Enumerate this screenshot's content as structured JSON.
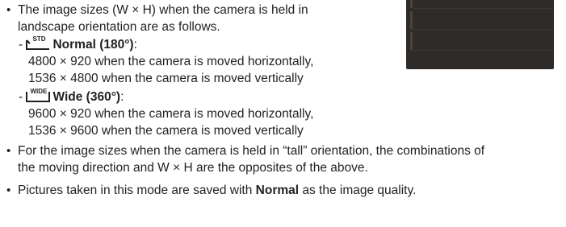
{
  "thumbnail": {
    "kind": "dark-image-thumbnail"
  },
  "bullets": [
    {
      "lines": [
        "The image sizes (W × H) when the camera is held in",
        "landscape orientation are as follows."
      ]
    }
  ],
  "modes": [
    {
      "icon_label": "STD",
      "name": "Normal (180°)",
      "suffix": ":",
      "lines": [
        "4800 × 920 when the camera is moved horizontally,",
        "1536 × 4800 when the camera is moved vertically"
      ]
    },
    {
      "icon_label": "WIDE",
      "name": "Wide (360°)",
      "suffix": ":",
      "lines": [
        "9600 × 920 when the camera is moved horizontally,",
        "1536 × 9600 when the camera is moved vertically"
      ]
    }
  ],
  "bullet2": {
    "lines": [
      "For the image sizes when the camera is held in “tall” orientation, the combinations of",
      "the moving direction and W × H are the opposites of the above."
    ]
  },
  "bullet3": {
    "before": "Pictures taken in this mode are saved with ",
    "bold": "Normal",
    "after": " as the image quality."
  },
  "markers": {
    "bullet": "•",
    "dash": "-"
  }
}
